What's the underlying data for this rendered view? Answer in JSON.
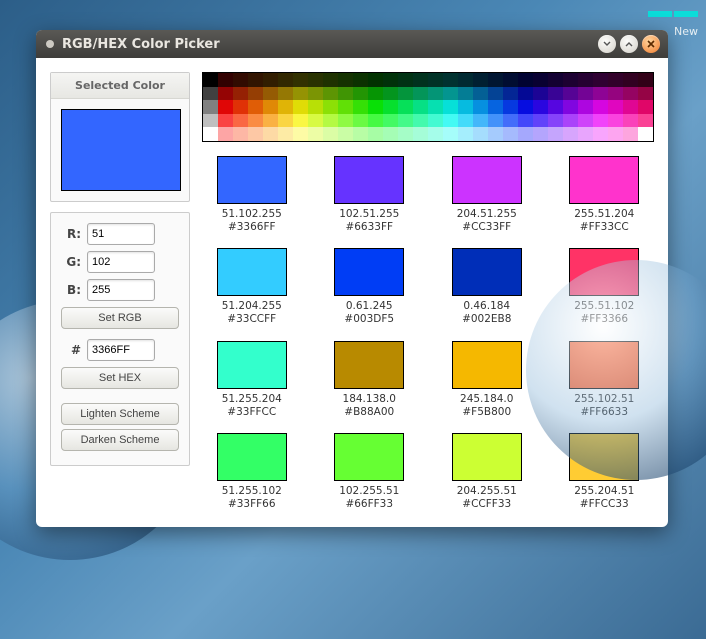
{
  "desktop": {
    "panel_label": "New"
  },
  "window": {
    "title": "RGB/HEX Color Picker"
  },
  "sidebar": {
    "selected_heading": "Selected Color",
    "selected_hex": "#3366FF",
    "labels": {
      "r": "R:",
      "g": "G:",
      "b": "B:",
      "hash": "#"
    },
    "values": {
      "r": "51",
      "g": "102",
      "b": "255",
      "hex": "3366FF"
    },
    "buttons": {
      "set_rgb": "Set RGB",
      "set_hex": "Set HEX",
      "lighten": "Lighten Scheme",
      "darken": "Darken Scheme"
    }
  },
  "palette": {
    "rows": 5,
    "cols": 30
  },
  "scheme": [
    {
      "rgb": "51.102.255",
      "hex": "#3366FF"
    },
    {
      "rgb": "102.51.255",
      "hex": "#6633FF"
    },
    {
      "rgb": "204.51.255",
      "hex": "#CC33FF"
    },
    {
      "rgb": "255.51.204",
      "hex": "#FF33CC"
    },
    {
      "rgb": "51.204.255",
      "hex": "#33CCFF"
    },
    {
      "rgb": "0.61.245",
      "hex": "#003DF5"
    },
    {
      "rgb": "0.46.184",
      "hex": "#002EB8"
    },
    {
      "rgb": "255.51.102",
      "hex": "#FF3366"
    },
    {
      "rgb": "51.255.204",
      "hex": "#33FFCC"
    },
    {
      "rgb": "184.138.0",
      "hex": "#B88A00"
    },
    {
      "rgb": "245.184.0",
      "hex": "#F5B800"
    },
    {
      "rgb": "255.102.51",
      "hex": "#FF6633"
    },
    {
      "rgb": "51.255.102",
      "hex": "#33FF66"
    },
    {
      "rgb": "102.255.51",
      "hex": "#66FF33"
    },
    {
      "rgb": "204.255.51",
      "hex": "#CCFF33"
    },
    {
      "rgb": "255.204.51",
      "hex": "#FFCC33"
    }
  ]
}
